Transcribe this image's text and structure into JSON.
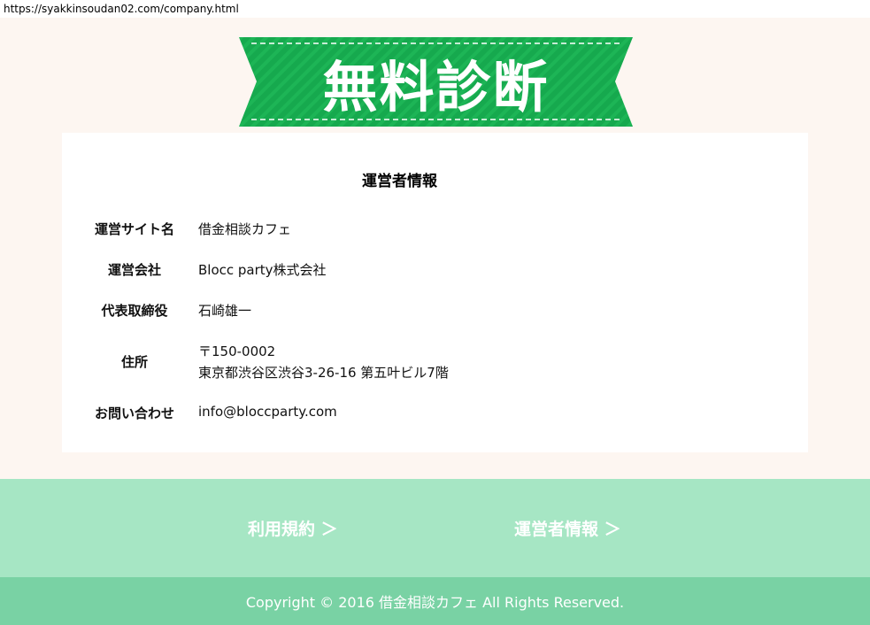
{
  "browser": {
    "url": "https://syakkinsoudan02.com/company.html"
  },
  "banner": {
    "text": "無料診断",
    "color": "#16a94e"
  },
  "company": {
    "title": "運営者情報",
    "rows": [
      {
        "label": "運営サイト名",
        "value": "借金相談カフェ"
      },
      {
        "label": "運営会社",
        "value": "Blocc party株式会社"
      },
      {
        "label": "代表取締役",
        "value": "石崎雄一"
      },
      {
        "label": "住所",
        "value_line1": "〒150-0002",
        "value_line2": "東京都渋谷区渋谷3-26-16 第五叶ビル7階"
      },
      {
        "label": "お問い合わせ",
        "value": "info@bloccparty.com"
      }
    ]
  },
  "footer": {
    "links": [
      {
        "label": "利用規約 ＞"
      },
      {
        "label": "運営者情報 ＞"
      }
    ],
    "copyright": "Copyright © 2016 借金相談カフェ All Rights Reserved.",
    "nav_bg": "#a6e6c4",
    "copyright_bg": "#79d2a4"
  }
}
